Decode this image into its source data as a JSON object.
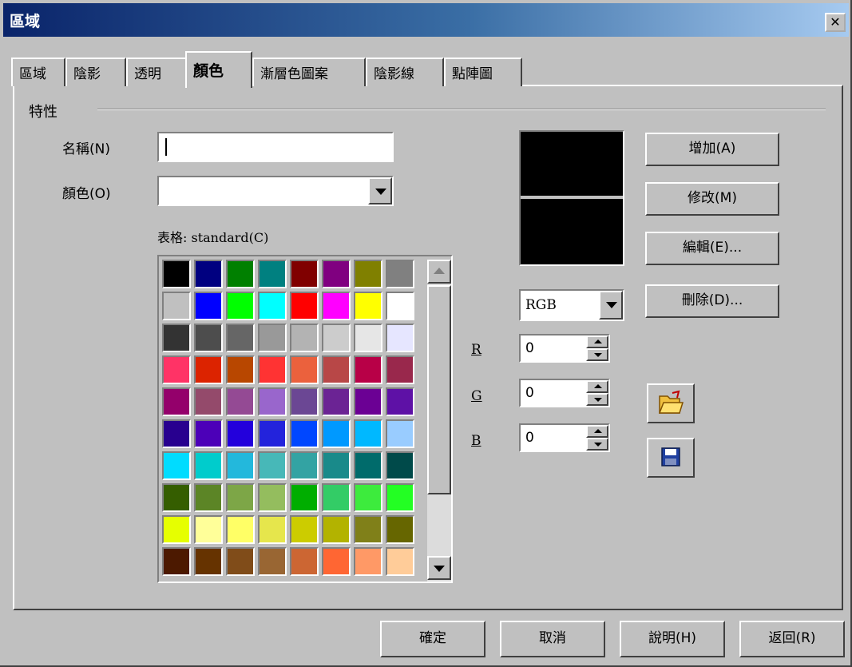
{
  "window": {
    "title": "區域",
    "close_glyph": "✕"
  },
  "tabs": [
    {
      "label": "區域",
      "active": false
    },
    {
      "label": "陰影",
      "active": false
    },
    {
      "label": "透明",
      "active": false
    },
    {
      "label": "顏色",
      "active": true
    },
    {
      "label": "漸層色圖案",
      "active": false
    },
    {
      "label": "陰影線",
      "active": false
    },
    {
      "label": "點陣圖",
      "active": false
    }
  ],
  "properties": {
    "group_title": "特性",
    "name_label": "名稱(N)",
    "name_value": "",
    "color_label": "顏色(O)",
    "color_value": "",
    "table_label": "表格: standard(C)"
  },
  "palette": [
    "#000000",
    "#000080",
    "#008000",
    "#008080",
    "#800000",
    "#800080",
    "#808000",
    "#808080",
    "#c0c0c0",
    "#0000ff",
    "#00ff00",
    "#00ffff",
    "#ff0000",
    "#ff00ff",
    "#ffff00",
    "#ffffff",
    "#333333",
    "#4d4d4d",
    "#666666",
    "#999999",
    "#b3b3b3",
    "#cccccc",
    "#e6e6e6",
    "#e6e6ff",
    "#ff3366",
    "#dc2300",
    "#b84700",
    "#ff3333",
    "#eb613d",
    "#b84747",
    "#b80047",
    "#99284c",
    "#94006b",
    "#944a6b",
    "#944a94",
    "#9966cc",
    "#6b4794",
    "#6b2394",
    "#6b0094",
    "#5e11a6",
    "#28008f",
    "#4c00b8",
    "#2300dc",
    "#2323dc",
    "#0047ff",
    "#0099ff",
    "#00b8ff",
    "#99ccff",
    "#00dcff",
    "#00cccc",
    "#23b8dc",
    "#47b8b8",
    "#33a3a3",
    "#198a8a",
    "#006b6b",
    "#004a4a",
    "#355e00",
    "#5c8526",
    "#7da647",
    "#94bd5e",
    "#00ae00",
    "#33cc66",
    "#3deb3d",
    "#23ff23",
    "#e6ff00",
    "#ffff99",
    "#ffff66",
    "#e6e64c",
    "#cccc00",
    "#b3b300",
    "#808019",
    "#666600",
    "#4c1900",
    "#663300",
    "#804c19",
    "#996633",
    "#cc6633",
    "#ff6633",
    "#ff9966",
    "#ffcc99"
  ],
  "color_model": "RGB",
  "rgb": {
    "r_label": "R",
    "r_value": "0",
    "g_label": "G",
    "g_value": "0",
    "b_label": "B",
    "b_value": "0"
  },
  "preview": {
    "old_color": "#000000",
    "new_color": "#000000"
  },
  "buttons": {
    "add": "增加(A)",
    "modify": "修改(M)",
    "edit": "編輯(E)...",
    "delete": "刪除(D)...",
    "ok": "確定",
    "cancel": "取消",
    "help": "說明(H)",
    "back": "返回(R)"
  },
  "icons": {
    "load": "open-folder-icon",
    "save": "floppy-save-icon"
  }
}
